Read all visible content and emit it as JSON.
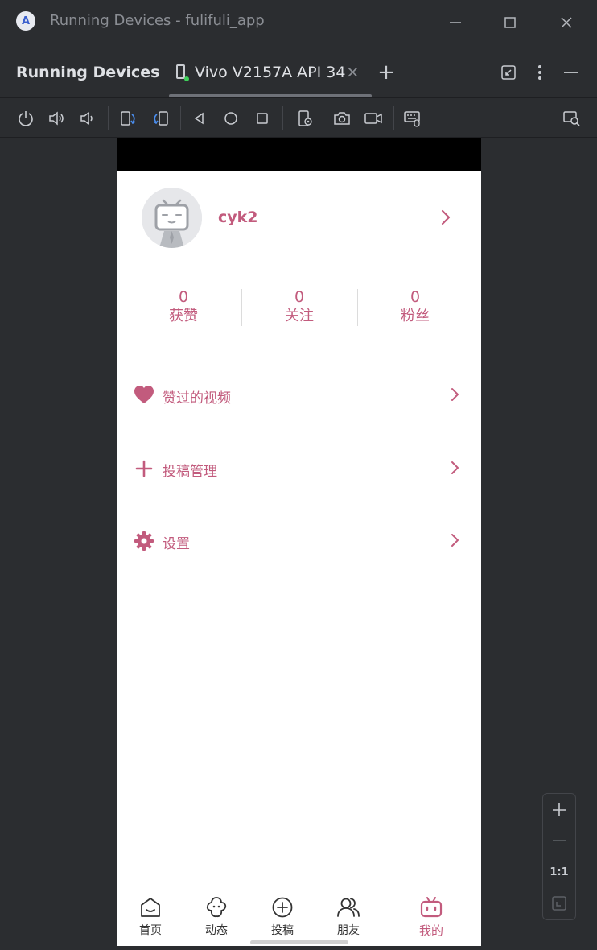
{
  "window": {
    "title": "Running Devices - fulifuli_app",
    "app_icon_letter": "A"
  },
  "tool_window": {
    "title": "Running Devices",
    "tab_label": "Vivo V2157A API 34",
    "tab_close": "×",
    "add_tab": "+"
  },
  "toolbar": {
    "buttons": [
      "power-icon",
      "volume-up-icon",
      "volume-down-icon",
      "rotate-left-icon",
      "rotate-right-icon",
      "back-icon",
      "home-icon",
      "overview-icon",
      "device-settings-icon",
      "screenshot-icon",
      "screen-record-icon",
      "keyboard-icon",
      "mirror-search-icon"
    ]
  },
  "profile": {
    "username": "cyk2"
  },
  "stats": [
    {
      "value": "0",
      "label": "获赞"
    },
    {
      "value": "0",
      "label": "关注"
    },
    {
      "value": "0",
      "label": "粉丝"
    }
  ],
  "menu": [
    {
      "label": "赞过的视频",
      "icon": "heart-icon"
    },
    {
      "label": "投稿管理",
      "icon": "plus-icon"
    },
    {
      "label": "设置",
      "icon": "gear-icon"
    }
  ],
  "bottom_nav": [
    {
      "label": "首页",
      "icon": "home-smile-icon"
    },
    {
      "label": "动态",
      "icon": "trends-icon"
    },
    {
      "label": "投稿",
      "icon": "add-circle-icon"
    },
    {
      "label": "朋友",
      "icon": "friends-icon"
    },
    {
      "label": "我的",
      "icon": "tv-icon",
      "active": true
    }
  ],
  "zoom": {
    "actual_size_label": "1:1"
  },
  "colors": {
    "accent": "#c25b7d",
    "ide_background": "#2b2d30",
    "device_screen": "#ffffff"
  }
}
